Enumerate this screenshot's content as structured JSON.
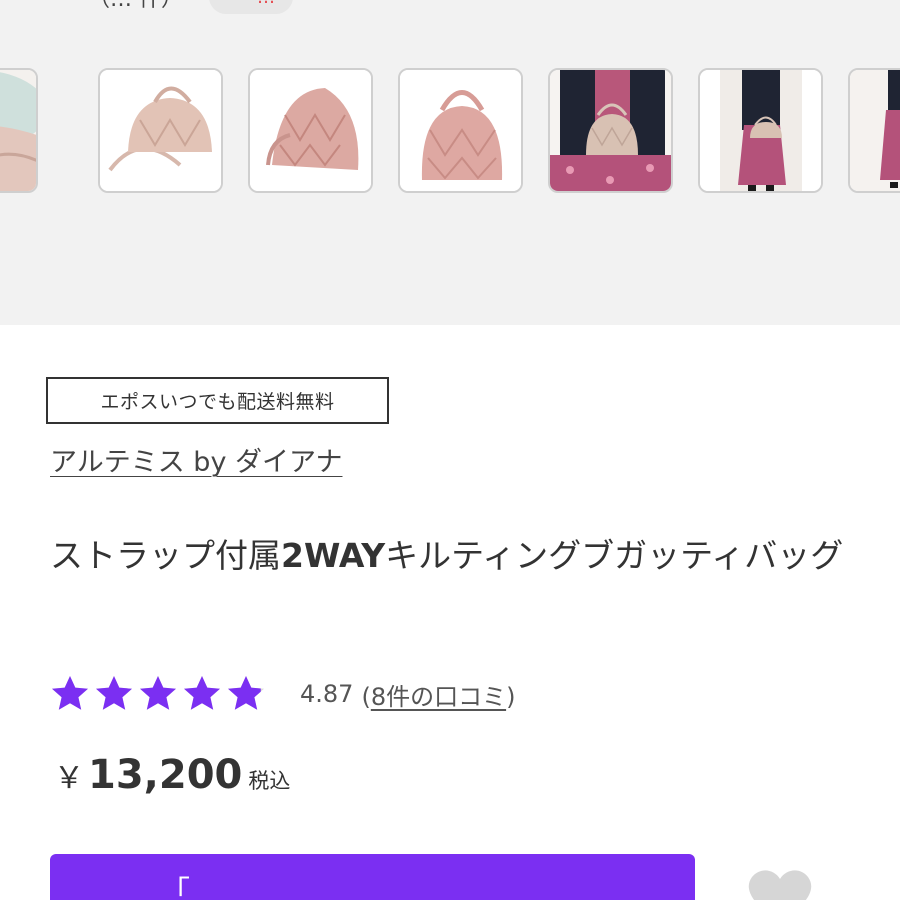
{
  "header_partial": {
    "prev_text": "（… 件）",
    "pill_label": "ー",
    "pill_highlight": "…"
  },
  "gallery": {
    "thumbnails": [
      {
        "name": "thumb-bag-interior",
        "alt": "bag interior"
      },
      {
        "name": "thumb-bag-with-strap",
        "alt": "bag with strap"
      },
      {
        "name": "thumb-bag-angle",
        "alt": "bag angle view"
      },
      {
        "name": "thumb-bag-front",
        "alt": "bag front view"
      },
      {
        "name": "thumb-model-holding",
        "alt": "model holding bag"
      },
      {
        "name": "thumb-model-full",
        "alt": "model full body"
      },
      {
        "name": "thumb-model-partial",
        "alt": "model partial"
      }
    ]
  },
  "product": {
    "shipping_badge": "エポスいつでも配送料無料",
    "brand": "アルテミス by ダイアナ",
    "title_part1": "ストラップ付属",
    "title_bold": "2WAY",
    "title_part2": "キルティングブガッティバッグ",
    "rating_value": "4.87",
    "rating_fraction": 0.974,
    "review_open": "(",
    "review_link": "8件の口コミ",
    "review_close": ")",
    "currency": "￥",
    "price": "13,200",
    "tax_label": "税込",
    "cart_button_label": "「"
  },
  "colors": {
    "accent": "#7b2ff2",
    "star_empty": "#d9d9d9",
    "band_bg": "#f2f2f2"
  }
}
